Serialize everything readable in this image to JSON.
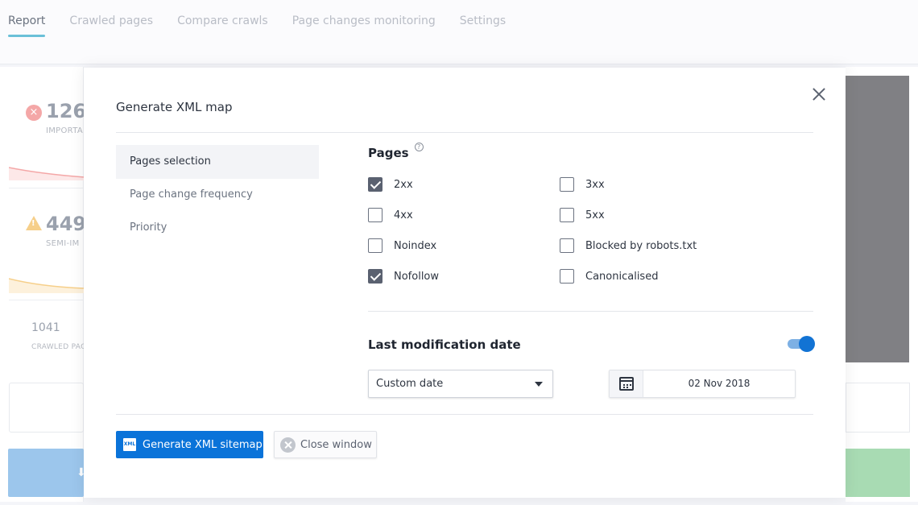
{
  "nav": {
    "tabs": [
      {
        "label": "Report",
        "active": true
      },
      {
        "label": "Crawled pages"
      },
      {
        "label": "Compare crawls"
      },
      {
        "label": "Page changes monitoring"
      },
      {
        "label": "Settings"
      }
    ]
  },
  "background": {
    "stat_important": {
      "value": "126",
      "label": "IMPORTA"
    },
    "stat_semi": {
      "value": "449",
      "label": "SEMI-IM"
    },
    "stat_crawled": {
      "value": "1041",
      "label": "CRAWLED PAG"
    },
    "colors": {
      "error": "#f4a7a7",
      "warning": "#f6cf8a"
    }
  },
  "modal": {
    "title": "Generate XML map",
    "sidenav": [
      {
        "label": "Pages selection",
        "active": true
      },
      {
        "label": "Page change frequency"
      },
      {
        "label": "Priority"
      }
    ],
    "pages": {
      "title": "Pages",
      "help": "?",
      "options": [
        {
          "label": "2xx",
          "checked": true
        },
        {
          "label": "3xx",
          "checked": false
        },
        {
          "label": "4xx",
          "checked": false
        },
        {
          "label": "5xx",
          "checked": false
        },
        {
          "label": "Noindex",
          "checked": false
        },
        {
          "label": "Blocked by robots.txt",
          "checked": false
        },
        {
          "label": "Nofollow",
          "checked": true
        },
        {
          "label": "Canonicalised",
          "checked": false
        }
      ]
    },
    "last_mod": {
      "title": "Last modification date",
      "enabled": true,
      "select_value": "Custom date",
      "date_value": "02 Nov 2018"
    },
    "buttons": {
      "generate_icon_text": "XML",
      "generate_label": "Generate XML sitemap",
      "close_label": "Close window"
    },
    "accent_color": "#0a73d9"
  }
}
